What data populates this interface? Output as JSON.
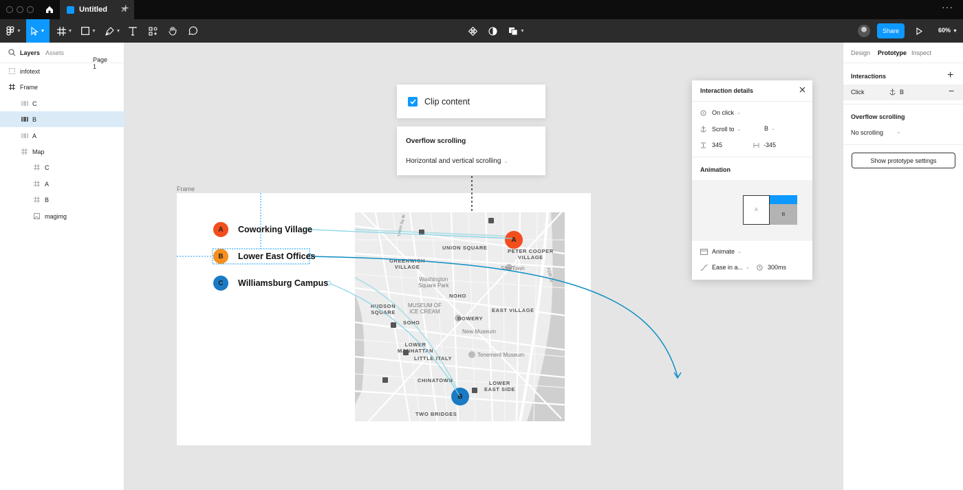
{
  "titlebar": {
    "tab_title": "Untitled"
  },
  "toolbar": {
    "zoom": "60%",
    "share_label": "Share"
  },
  "layers_panel": {
    "tabs": [
      "Layers",
      "Assets"
    ],
    "page": "Page 1",
    "items": [
      {
        "label": "infotext",
        "icon": "text-frame-icon",
        "indent": 0,
        "selected": false
      },
      {
        "label": "Frame",
        "icon": "frame-icon",
        "indent": 0,
        "selected": false
      },
      {
        "label": "C",
        "icon": "component-icon",
        "indent": 1,
        "selected": false
      },
      {
        "label": "B",
        "icon": "component-icon",
        "indent": 1,
        "selected": true
      },
      {
        "label": "A",
        "icon": "component-icon",
        "indent": 1,
        "selected": false
      },
      {
        "label": "Map",
        "icon": "frame-icon",
        "indent": 1,
        "selected": false
      },
      {
        "label": "C",
        "icon": "frame-icon",
        "indent": 2,
        "selected": false
      },
      {
        "label": "A",
        "icon": "frame-icon",
        "indent": 2,
        "selected": false
      },
      {
        "label": "B",
        "icon": "frame-icon",
        "indent": 2,
        "selected": false
      },
      {
        "label": "magimg",
        "icon": "image-icon",
        "indent": 2,
        "selected": false
      }
    ]
  },
  "right_panel": {
    "tabs": [
      "Design",
      "Prototype",
      "Inspect"
    ],
    "interactions_title": "Interactions",
    "interaction_trigger": "Click",
    "interaction_target": "B",
    "overflow_title": "Overflow scrolling",
    "overflow_value": "No scrolling",
    "prototype_settings_button": "Show prototype settings"
  },
  "canvas": {
    "frame_label": "Frame",
    "clip_content_label": "Clip content",
    "overflow_popup": {
      "title": "Overflow scrolling",
      "value": "Horizontal and vertical scrolling"
    },
    "locations": [
      {
        "letter": "A",
        "name": "Coworking Village",
        "color": "#f24e1e"
      },
      {
        "letter": "B",
        "name": "Lower East Offices",
        "color": "#f5901e"
      },
      {
        "letter": "C",
        "name": "Williamsburg Campus",
        "color": "#1a7ac4"
      }
    ],
    "map_labels": {
      "union_square": "UNION SQUARE",
      "peter_cooper": "PETER COOPER\nVILLAGE",
      "greenwich": "GREENWICH\nVILLAGE",
      "washington": "Washington\nSquare Park",
      "stuytown": "StuyTown",
      "noho": "NOHO",
      "hudson": "HUDSON\nSQUARE",
      "museum_ice": "MUSEUM OF\nICE CREAM",
      "soho": "SOHO",
      "bowery": "BOWERY",
      "east_village": "EAST VILLAGE",
      "new_museum": "New Museum",
      "lower_manhattan": "LOWER\nMANHATTAN",
      "little_italy": "LITTLE ITALY",
      "tenement": "Tenement Museum",
      "chinatown": "CHINATOWN",
      "lower_east_side": "LOWER\nEAST SIDE",
      "two_bridges": "TWO BRIDGES",
      "union_sq_st": "Union Sq W",
      "fdr": "FDR Dr"
    },
    "map_pins": [
      {
        "letter": "A",
        "color": "#f24e1e"
      },
      {
        "letter": "B",
        "color": "#1a7ac4"
      }
    ]
  },
  "interaction_details": {
    "title": "Interaction details",
    "trigger": "On click",
    "action": "Scroll to",
    "target": "B",
    "offset_y": "345",
    "offset_x": "-345",
    "animation_title": "Animation",
    "preview_left": "A",
    "preview_right": "B",
    "animation_type": "Animate",
    "easing": "Ease in a...",
    "duration": "300ms"
  },
  "colors": {
    "accent": "#0d99ff",
    "canvas": "#e5e5e5",
    "toolbar": "#2c2c2c"
  }
}
